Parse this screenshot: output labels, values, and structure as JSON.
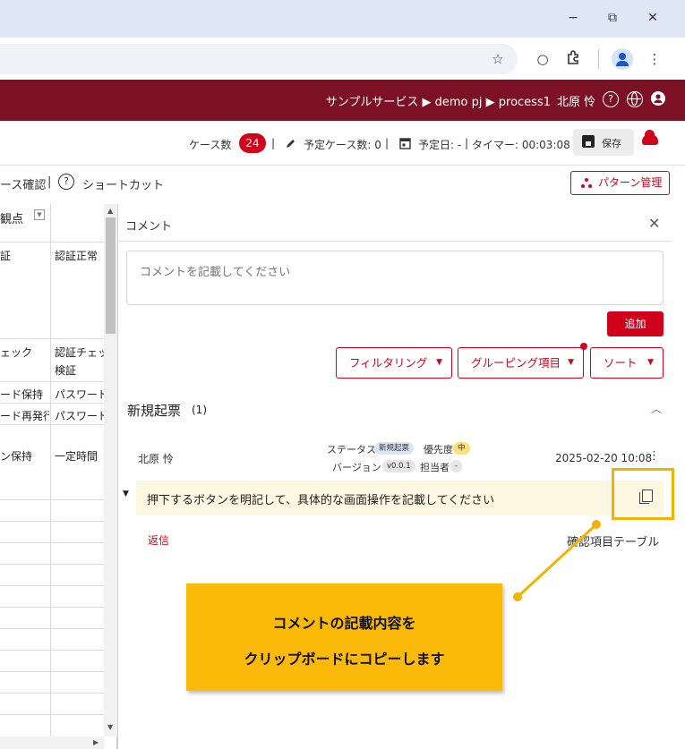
{
  "browser": {
    "window_controls": {
      "minimize": "−",
      "restore": "⧉",
      "close": "✕"
    },
    "toolbar_icons": [
      "star-icon",
      "circle-icon",
      "extensions-icon",
      "profile-icon",
      "menu-icon"
    ]
  },
  "app_header": {
    "breadcrumb": "サンプルサービス ▶ demo pj ▶ process1",
    "user": "北原 怜",
    "help_glyph": "?",
    "globe_glyph": "⊕"
  },
  "stats": {
    "case_count_label": "ケース数",
    "case_count": "24",
    "planned_cases": "予定ケース数: 0",
    "planned_date": "予定日: -",
    "timer": "タイマー: 00:03:08",
    "save_label": "保存",
    "sep": "|"
  },
  "row3": {
    "left_text": "ース確認",
    "sep": "|",
    "shortcut_label": "ショートカット",
    "pattern_button": "パターン管理"
  },
  "table": {
    "header_col1": "観点",
    "header_filter": "▼",
    "rows": [
      {
        "c1": "証",
        "c2": "認証正常"
      },
      {
        "c1": "ェック",
        "c2": "認証チェッ",
        "c2b": "検証"
      },
      {
        "c1": "ード保持",
        "c2": "パスワードィ"
      },
      {
        "c1": "ード再発行",
        "c2": "パスワード"
      },
      {
        "c1": "ン保持",
        "c2": "一定時間"
      }
    ]
  },
  "comment_panel": {
    "title": "コメント",
    "input_placeholder": "コメントを記載してください",
    "add_button": "追加",
    "filter_button": "フィルタリング",
    "grouping_button": "グルーピング項目",
    "sort_button": "ソート",
    "section_title": "新規起票",
    "section_count": "(1)",
    "comment": {
      "author": "北原 怜",
      "status_label": "ステータス",
      "status_value": "新規起票",
      "priority_label": "優先度",
      "priority_value": "中",
      "version_label": "バージョン",
      "version_value": "v0.0.1",
      "assignee_label": "担当者",
      "assignee_value": "-",
      "date": "2025-02-20 10:08",
      "body": "押下するボタンを明記して、具体的な画面操作を記載してください",
      "reply_label": "返信",
      "target": "確認項目テーブル"
    }
  },
  "callout": {
    "line1": "コメントの記載内容を",
    "line2": "クリップボードにコピーします",
    "color": "#fbb90a"
  },
  "colors": {
    "brand": "#7c1126",
    "accent": "#d0021b",
    "highlight": "#f0b400"
  }
}
